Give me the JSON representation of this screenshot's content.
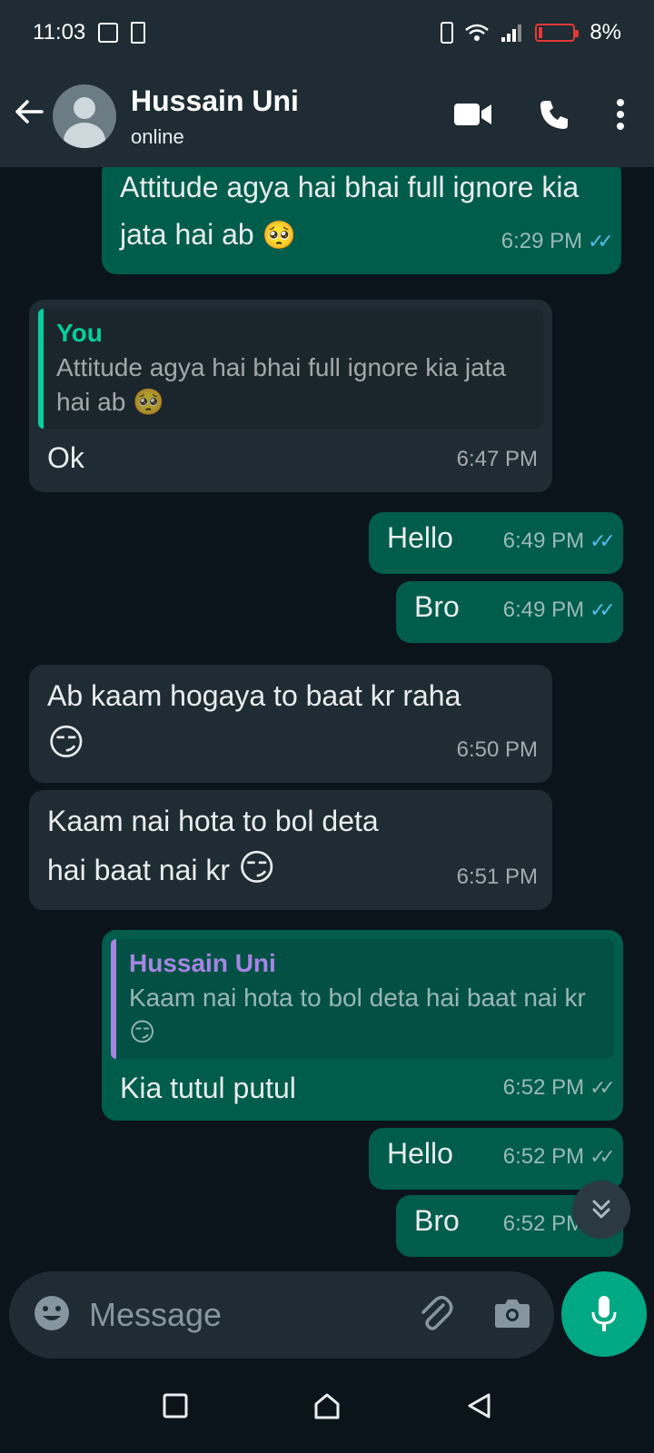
{
  "status_bar": {
    "time": "11:03",
    "battery_percent": "8%"
  },
  "header": {
    "contact_name": "Hussain Uni",
    "contact_status": "online",
    "icons": [
      "back-arrow-icon",
      "avatar",
      "video-call-icon",
      "phone-icon",
      "more-options-icon"
    ]
  },
  "messages": [
    {
      "direction": "out",
      "text": "Attitude agya hai bhai full ignore kia jata hai ab",
      "emoji": "🥺",
      "time": "6:29 PM",
      "read": true
    },
    {
      "direction": "in",
      "quote_author": "You",
      "quote_text": "Attitude agya hai bhai full ignore kia jata hai ab",
      "quote_emoji": "🥺",
      "text": "Ok",
      "time": "6:47 PM"
    },
    {
      "direction": "out",
      "text": "Hello",
      "time": "6:49 PM",
      "read": true
    },
    {
      "direction": "out",
      "text": "Bro",
      "time": "6:49 PM",
      "read": true
    },
    {
      "direction": "in",
      "text": "Ab kaam hogaya to baat kr raha",
      "emoji": "😏",
      "time": "6:50 PM"
    },
    {
      "direction": "in",
      "text": "Kaam nai hota to bol deta hai baat nai kr",
      "emoji": "😏",
      "time": "6:51 PM"
    },
    {
      "direction": "out",
      "quote_author": "Hussain Uni",
      "quote_text": "Kaam nai hota to bol deta hai baat nai kr",
      "quote_emoji": "😏",
      "text": "Kia tutul putul",
      "time": "6:52 PM",
      "read": false
    },
    {
      "direction": "out",
      "text": "Hello",
      "time": "6:52 PM",
      "read": false
    },
    {
      "direction": "out",
      "text": "Bro",
      "time": "6:52 PM",
      "read": false
    }
  ],
  "composer": {
    "placeholder": "Message"
  },
  "colors": {
    "outgoing_bubble": "#005c4b",
    "incoming_bubble": "#202c33",
    "accent": "#00a884",
    "read_ticks": "#53bdeb"
  }
}
